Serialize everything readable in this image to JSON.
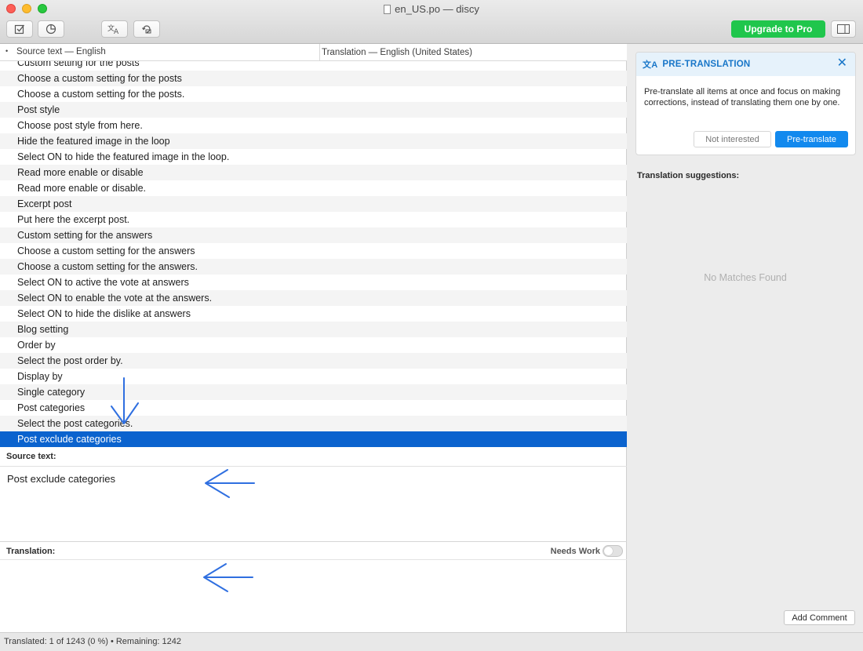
{
  "window": {
    "title": "en_US.po — discy"
  },
  "toolbar": {
    "buttons": [
      {
        "icon": "checkbox-icon"
      },
      {
        "icon": "pie-chart-icon"
      },
      {
        "icon": "translate-icon"
      },
      {
        "icon": "sync-icon"
      }
    ],
    "upgrade_label": "Upgrade to Pro",
    "sidebar_toggle_icon": "sidebar-icon"
  },
  "list": {
    "columns": [
      "Source text — English",
      "Translation — English (United States)"
    ],
    "rows": [
      "Custom setting for the posts",
      "Choose a custom setting for the posts",
      "Choose a custom setting for the posts.",
      "Post style",
      "Choose post style from here.",
      "Hide the featured image in the loop",
      "Select ON to hide the featured image in the loop.",
      "Read more enable or disable",
      "Read more enable or disable.",
      "Excerpt post",
      "Put here the excerpt post.",
      "Custom setting for the answers",
      "Choose a custom setting for the answers",
      "Choose a custom setting for the answers.",
      "Select ON to active the vote at answers",
      "Select ON to enable the vote at the answers.",
      "Select ON to hide the dislike at answers",
      "Blog setting",
      "Order by",
      "Select the post order by.",
      "Display by",
      "Single category",
      "Post categories",
      "Select the post categories.",
      "Post exclude categories"
    ],
    "selected_index": 24
  },
  "editor": {
    "source_label": "Source text:",
    "source_value": "Post exclude categories",
    "translation_label": "Translation:",
    "needs_work_label": "Needs Work",
    "needs_work_on": false,
    "translation_value": ""
  },
  "pretranslation": {
    "title": "PRE-TRANSLATION",
    "body": "Pre-translate all items at once and focus on making corrections, instead of translating them one by one.",
    "not_interested": "Not interested",
    "pretranslate": "Pre-translate"
  },
  "suggestions": {
    "label": "Translation suggestions:",
    "empty": "No Matches Found"
  },
  "add_comment_label": "Add Comment",
  "status": {
    "text": "Translated: 1 of 1243 (0 %)  •  Remaining: 1242"
  },
  "colors": {
    "accent": "#0b63ce",
    "upgrade": "#20c64c",
    "primary_button": "#1289ee",
    "annotation_arrow": "#2f6fe0"
  }
}
